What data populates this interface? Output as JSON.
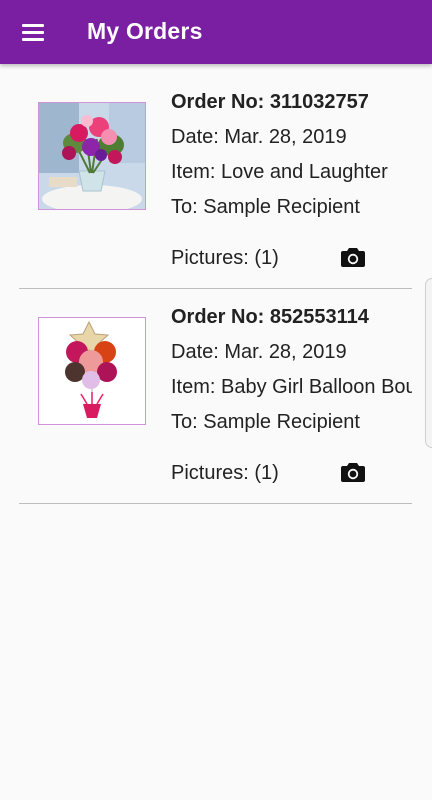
{
  "app_bar": {
    "title": "My Orders",
    "menu_icon": "hamburger-menu-icon",
    "background": "#7b1fa2"
  },
  "orders": [
    {
      "order_no": "Order No: 311032757",
      "date": "Date: Mar. 28, 2019",
      "item": "Item: Love and Laughter",
      "to": "To: Sample Recipient",
      "pictures": "Pictures: (1)",
      "thumbnail": "flower-bouquet-image",
      "action_icon": "camera-icon"
    },
    {
      "order_no": "Order No: 852553114",
      "date": "Date: Mar. 28, 2019",
      "item": "Item: Baby Girl Balloon Bouquet",
      "to": "To: Sample Recipient",
      "pictures": "Pictures: (1)",
      "thumbnail": "balloon-bouquet-image",
      "action_icon": "camera-icon"
    }
  ]
}
